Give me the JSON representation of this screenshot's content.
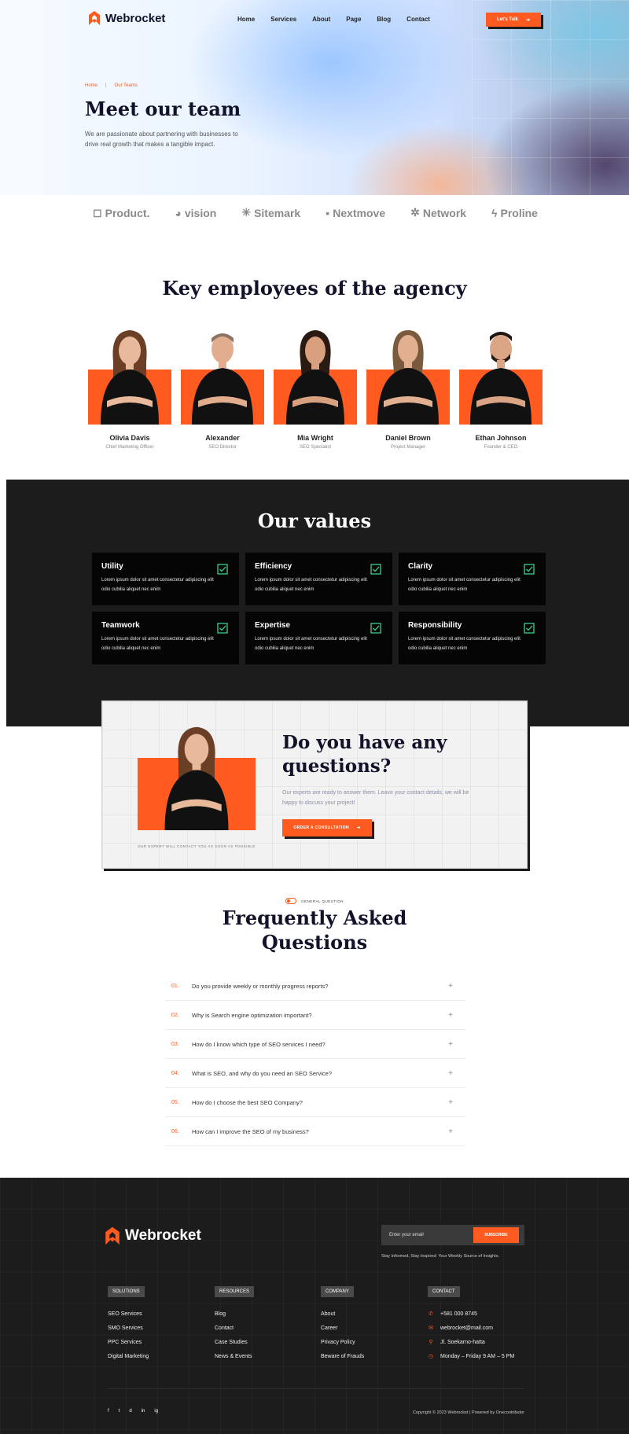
{
  "brand": {
    "name": "Webrocket",
    "accent": "#ff5a1f",
    "dark": "#1c1c1c"
  },
  "nav": {
    "items": [
      "Home",
      "Services",
      "About",
      "Page",
      "Blog",
      "Contact"
    ],
    "cta_label": "Let's Talk",
    "cta_icon": "arrow-icon"
  },
  "hero": {
    "breadcrumb": [
      "Home",
      "Our Teams"
    ],
    "title": "Meet our team",
    "subtitle": "We are passionate about partnering with businesses to drive real growth that makes a tangible impact."
  },
  "brands": [
    "Product.",
    "vision",
    "Sitemark",
    "Nextmove",
    "Network",
    "Proline"
  ],
  "team": {
    "title": "Key employees of the agency",
    "members": [
      {
        "name": "Olivia Davis",
        "role": "Chief Marketing Officer"
      },
      {
        "name": "Alexander",
        "role": "SEO Director"
      },
      {
        "name": "Mia Wright",
        "role": "SEO Specialist"
      },
      {
        "name": "Daniel Brown",
        "role": "Project Manager"
      },
      {
        "name": "Ethan Johnson",
        "role": "Founder & CEO"
      }
    ]
  },
  "values": {
    "title": "Our values",
    "items": [
      {
        "title": "Utility",
        "desc": "Lorem ipsum dolor sit amet consectetur adipiscing elit odio cubilia aliquet nec enim"
      },
      {
        "title": "Efficiency",
        "desc": "Lorem ipsum dolor sit amet consectetur adipiscing elit odio cubilia aliquet nec enim"
      },
      {
        "title": "Clarity",
        "desc": "Lorem ipsum dolor sit amet consectetur adipiscing elit odio cubilia aliquet nec enim"
      },
      {
        "title": "Teamwork",
        "desc": "Lorem ipsum dolor sit amet consectetur adipiscing elit odio cubilia aliquet nec enim"
      },
      {
        "title": "Expertise",
        "desc": "Lorem ipsum dolor sit amet consectetur adipiscing elit odio cubilia aliquet nec enim"
      },
      {
        "title": "Responsibility",
        "desc": "Lorem ipsum dolor sit amet consectetur adipiscing elit odio cubilia aliquet nec enim"
      }
    ],
    "check_color": "#3ecf8e"
  },
  "questions": {
    "title": "Do you have any questions?",
    "subtitle": "Our experts are ready to answer them. Leave your contact details, we will be happy to discuss your project!",
    "button_label": "ORDER A CONSULTATION",
    "note": "OUR EXPERT WILL CONTACT YOU AS SOON AS POSSIBLE"
  },
  "faq": {
    "tag": "GENERAL QUESTION",
    "title": "Frequently Asked Questions",
    "items": [
      {
        "num": "01.",
        "q": "Do you provide weekly or monthly progress reports?"
      },
      {
        "num": "02.",
        "q": "Why is Search engine optimization important?"
      },
      {
        "num": "03.",
        "q": "How do I know which type of SEO services I need?"
      },
      {
        "num": "04.",
        "q": "What is SEO, and why do you need an SEO Service?"
      },
      {
        "num": "05.",
        "q": "How do I choose the best SEO Company?"
      },
      {
        "num": "06.",
        "q": "How can I improve the SEO of my business?"
      }
    ]
  },
  "footer": {
    "newsletter_placeholder": "Enter your email",
    "subscribe_label": "SUBSCRIBE",
    "newsletter_note": "Stay Informed, Stay Inspired: Your Weekly Source of Insights.",
    "columns": {
      "solutions": {
        "head": "SOLUTIONS",
        "links": [
          "SEO Services",
          "SMO Services",
          "PPC Services",
          "Digital Marketing"
        ]
      },
      "resources": {
        "head": "RESOURCES",
        "links": [
          "Blog",
          "Contact",
          "Case Studies",
          "News & Events"
        ]
      },
      "company": {
        "head": "COMPANY",
        "links": [
          "About",
          "Career",
          "Privacy Policy",
          "Beware of Frauds"
        ]
      },
      "contact": {
        "head": "CONTACT",
        "links": [
          "+581 000 8745",
          "webrocket@mail.com",
          "Jl. Soekarno-hatta",
          "Monday – Friday 9 AM – 5 PM"
        ]
      }
    },
    "socials": [
      "f",
      "t",
      "d",
      "in",
      "ig"
    ],
    "copyright": "Copyright © 2023 Webrocket | Powered by Onecontributor"
  }
}
